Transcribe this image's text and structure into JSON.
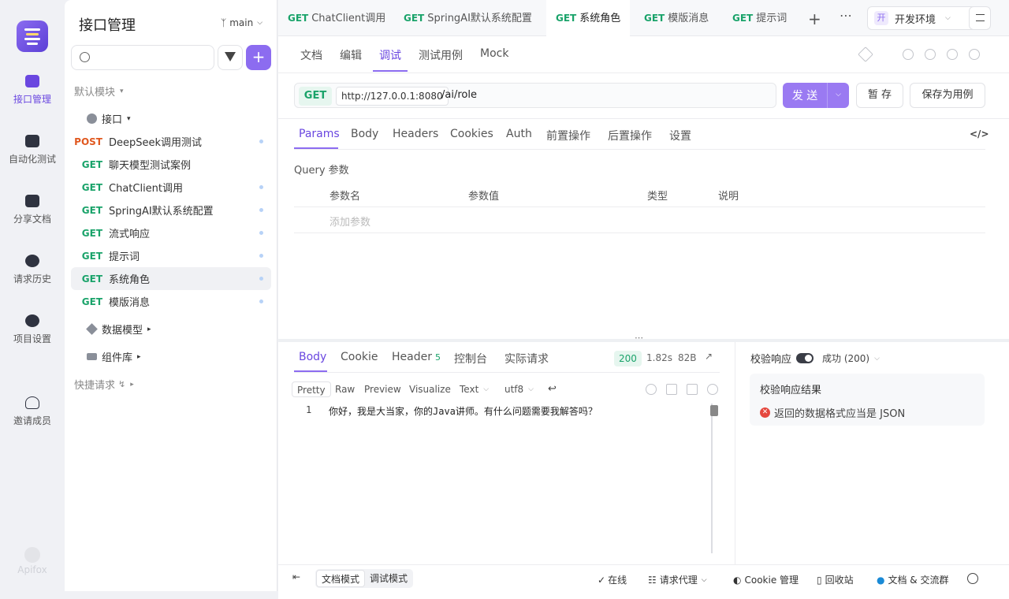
{
  "rail": {
    "items": [
      {
        "label": "接口管理",
        "icon": "api-icon"
      },
      {
        "label": "自动化测试",
        "icon": "automation-icon"
      },
      {
        "label": "分享文档",
        "icon": "book-icon"
      },
      {
        "label": "请求历史",
        "icon": "clock-icon"
      },
      {
        "label": "项目设置",
        "icon": "settings-icon"
      },
      {
        "label": "邀请成员",
        "icon": "add-user-icon"
      }
    ],
    "brand": "Apifox"
  },
  "tree": {
    "title": "接口管理",
    "branch": "main",
    "default_module": "默认模块",
    "folder": "接口",
    "items": [
      {
        "method": "POST",
        "name": "DeepSeek调用测试"
      },
      {
        "method": "GET",
        "name": "聊天模型测试案例"
      },
      {
        "method": "GET",
        "name": "ChatClient调用"
      },
      {
        "method": "GET",
        "name": "SpringAI默认系统配置"
      },
      {
        "method": "GET",
        "name": "流式响应"
      },
      {
        "method": "GET",
        "name": "提示词"
      },
      {
        "method": "GET",
        "name": "系统角色"
      },
      {
        "method": "GET",
        "name": "模版消息"
      }
    ],
    "data_model": "数据模型",
    "component_lib": "组件库",
    "quick_request": "快捷请求"
  },
  "tabs": [
    {
      "method": "GET",
      "name": "ChatClient调用"
    },
    {
      "method": "GET",
      "name": "SpringAI默认系统配置"
    },
    {
      "method": "GET",
      "name": "系统角色"
    },
    {
      "method": "GET",
      "name": "模版消息"
    },
    {
      "method": "GET",
      "name": "提示词"
    }
  ],
  "env": {
    "badge": "开",
    "name": "开发环境"
  },
  "subtabs": [
    "文档",
    "编辑",
    "调试",
    "测试用例",
    "Mock"
  ],
  "request": {
    "method": "GET",
    "host": "http://127.0.0.1:8080",
    "path": "/ai/role",
    "send": "发 送",
    "save": "暂 存",
    "save_case": "保存为用例"
  },
  "params_tabs": [
    "Params",
    "Body",
    "Headers",
    "Cookies",
    "Auth",
    "前置操作",
    "后置操作",
    "设置"
  ],
  "query": {
    "title": "Query 参数",
    "cols": [
      "参数名",
      "参数值",
      "类型",
      "说明"
    ],
    "add": "添加参数"
  },
  "response": {
    "tabs": [
      "Body",
      "Cookie",
      "Header",
      "控制台",
      "实际请求"
    ],
    "header_count": "5",
    "status": "200",
    "time": "1.82s",
    "size": "82B",
    "views": [
      "Pretty",
      "Raw",
      "Preview",
      "Visualize"
    ],
    "format": "Text",
    "encoding": "utf8",
    "line": "1",
    "content": "你好，我是大当家，你的Java讲师。有什么问题需要我解答吗？"
  },
  "validation": {
    "label": "校验响应",
    "status": "成功 (200)",
    "title": "校验响应结果",
    "message": "返回的数据格式应当是 JSON"
  },
  "footer": {
    "doc_mode": "文档模式",
    "debug_mode": "调试模式",
    "online": "在线",
    "proxy": "请求代理",
    "cookie": "Cookie 管理",
    "recycle": "回收站",
    "community": "文档 & 交流群"
  }
}
